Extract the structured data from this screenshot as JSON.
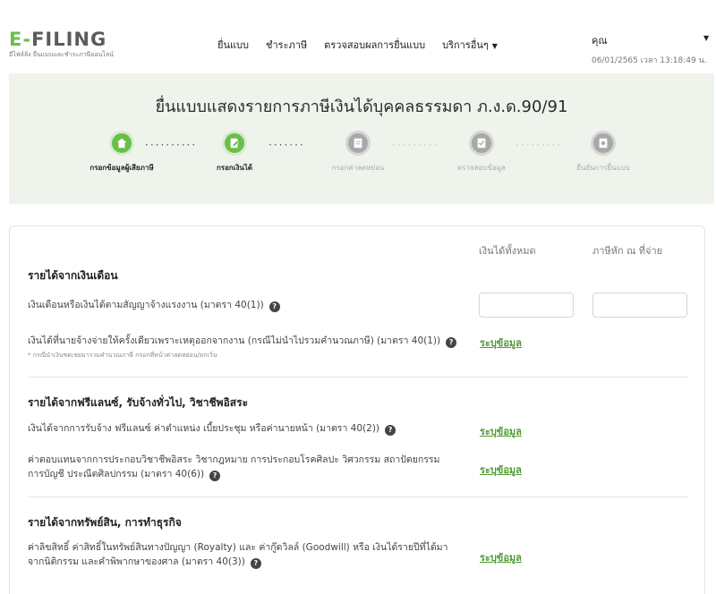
{
  "header": {
    "logo_main": "FILING",
    "logo_letter": "E",
    "logo_sub": "อีไฟล์ลิ่ง ยื่นแบบและชำระภาษีออนไลน์",
    "nav": {
      "file_return": "ยื่นแบบ",
      "pay_tax": "ชำระภาษี",
      "check_result": "ตรวจสอบผลการยื่นแบบ",
      "other_services": "บริการอื่นๆ"
    },
    "user_name": "คุณ",
    "datetime": "06/01/2565 เวลา 13:18:49 น."
  },
  "banner": {
    "title": "ยื่นแบบแสดงรายการภาษีเงินได้บุคคลธรรมดา ภ.ง.ด.90/91",
    "steps": [
      {
        "label": "กรอกข้อมูลผู้เสียภาษี",
        "state": "done",
        "icon": "home-icon"
      },
      {
        "label": "กรอกเงินได้",
        "state": "current",
        "icon": "edit-icon"
      },
      {
        "label": "กรอกค่าลดหย่อน",
        "state": "pending",
        "icon": "document-icon"
      },
      {
        "label": "ตรวจสอบข้อมูล",
        "state": "pending",
        "icon": "checklist-icon"
      },
      {
        "label": "ยืนยันการยื่นแบบ",
        "state": "pending",
        "icon": "confirm-icon"
      }
    ]
  },
  "form": {
    "col_total_income": "เงินได้ทั้งหมด",
    "col_withholding": "ภาษีหัก ณ ที่จ่าย",
    "sections": {
      "salary": {
        "title": "รายได้จากเงินเดือน",
        "row1": "เงินเดือนหรือเงินได้ตามสัญญาจ้างแรงงาน (มาตรา 40(1))",
        "row2": "เงินได้ที่นายจ้างจ่ายให้ครั้งเดียวเพราะเหตุออกจากงาน (กรณีไม่นำไปรวมคำนวณภาษี) (มาตรา 40(1))",
        "row2_note": "* กรณีนำเงินชดเชยมารวมคำนวณภาษี กรอกที่หน้าค่าลดหย่อน/ยกเว้น",
        "row1_total_value": "",
        "row1_withholding_value": ""
      },
      "freelance": {
        "title": "รายได้จากฟรีแลนซ์, รับจ้างทั่วไป, วิชาชีพอิสระ",
        "row1": "เงินได้จากการรับจ้าง ฟรีแลนซ์ ค่าตำแหน่ง เบี้ยประชุม หรือค่านายหน้า (มาตรา 40(2))",
        "row2_line1": "ค่าตอบแทนจากการประกอบวิชาชีพอิสระ วิชากฎหมาย การประกอบโรคศิลปะ วิศวกรรม สถาปัตยกรรม",
        "row2_line2": "การบัญชี ประณีตศิลปกรรม (มาตรา 40(6))"
      },
      "assets": {
        "title": "รายได้จากทรัพย์สิน, การทำธุรกิจ",
        "row1_line1": "ค่าลิขสิทธิ์ ค่าสิทธิ์ในทรัพย์สินทางปัญญา (Royalty) และ ค่ากู๊ดวิลล์ (Goodwill) หรือ เงินได้รายปีที่ได้มา",
        "row1_line2": "จากนิติกรรม และคำพิพากษาของศาล (มาตรา 40(3))"
      }
    },
    "specify_link": "ระบุข้อมูล",
    "help_glyph": "?"
  },
  "colors": {
    "brand_green": "#6abf4b",
    "banner_bg": "#eef4ec",
    "link_green": "#4f9a32"
  }
}
